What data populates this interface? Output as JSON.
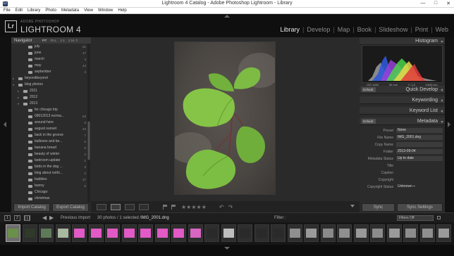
{
  "window": {
    "title": "Lightroom 4 Catalog - Adobe Photoshop Lightroom - Library",
    "controls": [
      "—",
      "□",
      "✕"
    ]
  },
  "menu": [
    "File",
    "Edit",
    "Library",
    "Photo",
    "Metadata",
    "View",
    "Window",
    "Help"
  ],
  "brand": {
    "badge": "Lr",
    "small": "ADOBE PHOTOSHOP",
    "big": "LIGHTROOM 4"
  },
  "modules": [
    {
      "label": "Library",
      "active": true
    },
    {
      "label": "Develop"
    },
    {
      "label": "Map"
    },
    {
      "label": "Book"
    },
    {
      "label": "Slideshow"
    },
    {
      "label": "Print"
    },
    {
      "label": "Web"
    }
  ],
  "navigator": {
    "title": "Navigator",
    "zoom": [
      "FIT",
      "FILL",
      "1:1",
      "1:16 ⇕"
    ]
  },
  "folders": [
    {
      "label": "july",
      "count": "51",
      "depth": 2
    },
    {
      "label": "june",
      "count": "47",
      "depth": 2
    },
    {
      "label": "march",
      "count": "4",
      "depth": 2
    },
    {
      "label": "may",
      "count": "44",
      "depth": 2
    },
    {
      "label": "september",
      "count": "3",
      "depth": 2
    },
    {
      "label": "beyondbeyond",
      "count": "",
      "depth": 0,
      "caret": "▸"
    },
    {
      "label": "blog photos",
      "count": "",
      "depth": 0,
      "caret": "▾"
    },
    {
      "label": "2011",
      "count": "",
      "depth": 1,
      "caret": "▸"
    },
    {
      "label": "2012",
      "count": "",
      "depth": 1,
      "caret": "▸"
    },
    {
      "label": "2013",
      "count": "",
      "depth": 1,
      "caret": "▾"
    },
    {
      "label": "for chicago trip",
      "count": "",
      "depth": 2
    },
    {
      "label": "09012013 norma...",
      "count": "53",
      "depth": 2
    },
    {
      "label": "around here",
      "count": "6",
      "depth": 2
    },
    {
      "label": "august sunset",
      "count": "34",
      "depth": 2
    },
    {
      "label": "back in the groove",
      "count": "7",
      "depth": 2
    },
    {
      "label": "balloons and be...",
      "count": "6",
      "depth": 2
    },
    {
      "label": "banana bread",
      "count": "6",
      "depth": 2
    },
    {
      "label": "beauty of winter",
      "count": "2",
      "depth": 2
    },
    {
      "label": "bedroom update",
      "count": "1",
      "depth": 2
    },
    {
      "label": "birds in the dog ...",
      "count": "3",
      "depth": 2
    },
    {
      "label": "blog about nothi...",
      "count": "2",
      "depth": 2
    },
    {
      "label": "bubbles",
      "count": "27",
      "depth": 2
    },
    {
      "label": "bunny",
      "count": "6",
      "depth": 2
    },
    {
      "label": "Chicago",
      "count": "",
      "depth": 2
    },
    {
      "label": "christmas",
      "count": "",
      "depth": 2
    }
  ],
  "left_buttons": {
    "import": "Import Catalog",
    "export": "Export Catalog"
  },
  "right_panels": {
    "histogram": "Histogram",
    "quick_develop": "Quick Develop",
    "quick_develop_preset": "Default",
    "keywording": "Keywording",
    "keyword_list": "Keyword List",
    "metadata": "Metadata",
    "metadata_preset": "Default"
  },
  "histogram_info": [
    "ISO 1600",
    "50 mm",
    "f / 1.8",
    "1/640 sec"
  ],
  "metadata_fields": [
    {
      "key": "Preset",
      "value": "None",
      "box": true
    },
    {
      "key": "File Name",
      "value": "IMG_2001.dng",
      "box": true
    },
    {
      "key": "Copy Name",
      "value": "",
      "box": true
    },
    {
      "key": "Folder",
      "value": "2013-09-04",
      "box": true
    },
    {
      "key": "Metadata Status",
      "value": "Up to date",
      "box": true
    },
    {
      "key": "Title",
      "value": "",
      "box": false
    },
    {
      "key": "Caption",
      "value": "",
      "box": false
    },
    {
      "key": "Copyright",
      "value": "",
      "box": false
    },
    {
      "key": "Copyright Status",
      "value": "Unknown ÷",
      "box": false
    }
  ],
  "right_buttons": {
    "sync": "Sync",
    "sync_settings": "Sync Settings"
  },
  "toolbar": {
    "stars": "★★★★★",
    "rotate_left": "↶",
    "rotate_right": "↷"
  },
  "filmstrip": {
    "screen1": "1",
    "screen2": "2",
    "source": "Previous Import",
    "count": "30 photos / 1 selected /",
    "filename": "IMG_2001.dng",
    "filter_label": "Filter :",
    "filter_value": "Filters Off",
    "back": "◀",
    "forward": "▶"
  },
  "thumb_colors": [
    "#6a8f4a",
    "#2f3a2a",
    "#5f7a58",
    "#a9b8a0",
    "#e15ac6",
    "#e15ac6",
    "#e15ac6",
    "#e15ac6",
    "#e15ac6",
    "#e15ac6",
    "#e15ac6",
    "#d866c2",
    "#2a2a2a",
    "#bfbfbf",
    "#2a2a2a",
    "#2a2a2a",
    "#2a2a2a",
    "#8f8f8f",
    "#9a9a9a",
    "#8a8a8a",
    "#8f8f8f",
    "#999999",
    "#8c8c8c",
    "#9a9a9a",
    "#8d8d8d",
    "#8f8f8f",
    "#9b9b9b"
  ]
}
